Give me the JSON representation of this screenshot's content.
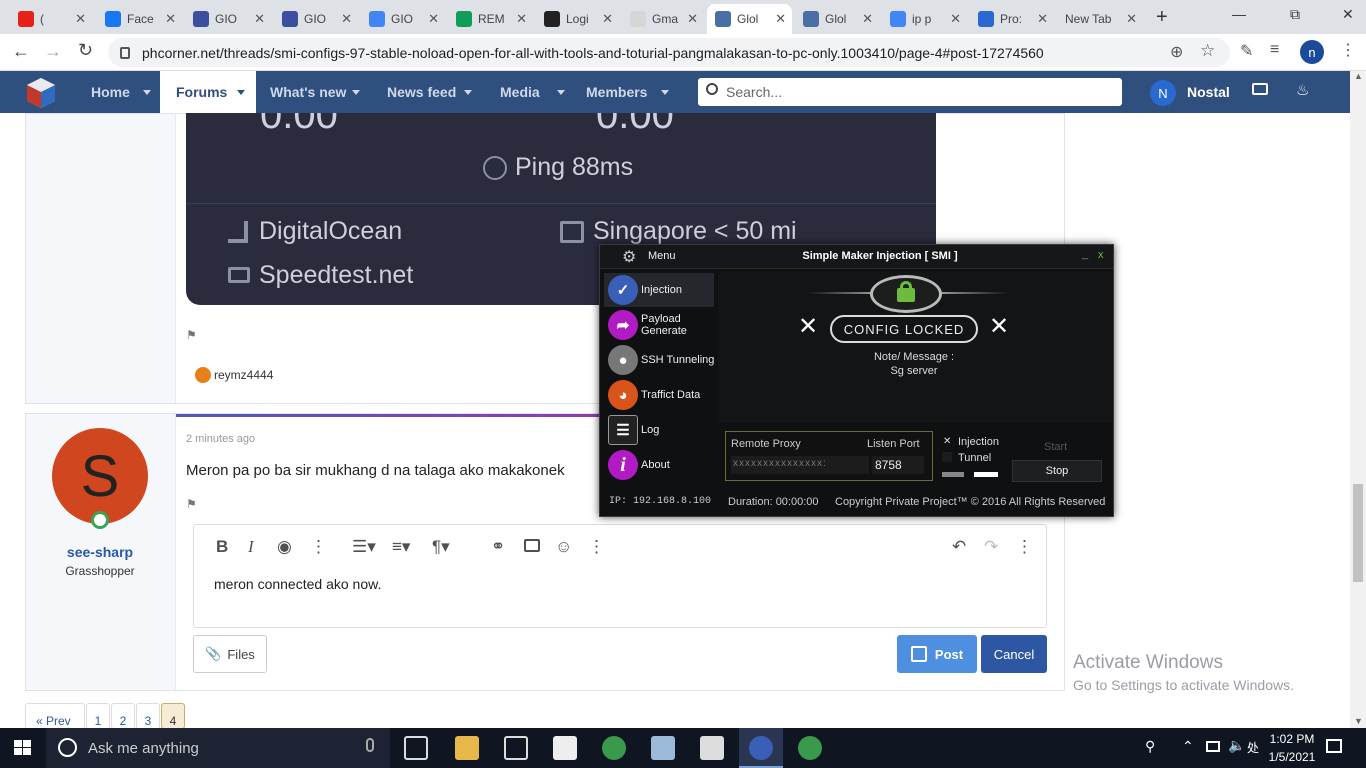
{
  "browser": {
    "tabs": [
      {
        "title": "(",
        "color": "#e62117",
        "active": false
      },
      {
        "title": "Face",
        "color": "#1877f2",
        "active": false
      },
      {
        "title": "GIO",
        "color": "#3c4f9e",
        "active": false
      },
      {
        "title": "GIO",
        "color": "#3c4f9e",
        "active": false
      },
      {
        "title": "GIO",
        "color": "#4285f4",
        "active": false
      },
      {
        "title": "REM",
        "color": "#0f9d58",
        "active": false
      },
      {
        "title": "Logi",
        "color": "#222222",
        "active": false
      },
      {
        "title": "Gma",
        "color": "#d6d6d6",
        "active": false
      },
      {
        "title": "Glol",
        "color": "#4a6fa5",
        "active": true
      },
      {
        "title": "Glol",
        "color": "#4a6fa5",
        "active": false
      },
      {
        "title": "ip p",
        "color": "#4285f4",
        "active": false
      },
      {
        "title": "Pro:",
        "color": "#2a6ad0",
        "active": false
      },
      {
        "title": "New Tab",
        "color": "",
        "active": false
      }
    ],
    "url": "phcorner.net/threads/smi-configs-97-stable-noload-open-for-all-with-tools-and-toturial-pangmalakasan-to-pc-only.1003410/page-4#post-17274560",
    "profile_initial": "n"
  },
  "site_nav": {
    "items": [
      "Home",
      "Forums",
      "What's new",
      "News feed",
      "Media",
      "Members"
    ],
    "search_placeholder": "Search...",
    "user_initial": "N",
    "username": "Nostal"
  },
  "speedtest": {
    "top_left": "0.00",
    "top_right": "0.00",
    "ping": "Ping 88ms",
    "provider": "DigitalOcean",
    "location": "Singapore < 50 mi",
    "site": "Speedtest.net"
  },
  "post1": {
    "reaction_user": "reymz4444"
  },
  "post2": {
    "avatar_letter": "S",
    "author": "see-sharp",
    "rank": "Grasshopper",
    "time": "2 minutes ago",
    "message": "Meron pa po ba sir mukhang d na talaga ako makakonek"
  },
  "editor": {
    "text": "meron connected ako now.",
    "files_label": "Files",
    "post_label": "Post",
    "cancel_label": "Cancel"
  },
  "pagination": {
    "prev": "« Prev",
    "pages": [
      "1",
      "2",
      "3",
      "4"
    ],
    "current": "4"
  },
  "smi": {
    "menu_label": "Menu",
    "title": "Simple Maker Injection [ SMI ]",
    "minimize": "_",
    "close": "x",
    "sidebar": [
      {
        "label": "Injection",
        "color": "#3a5fb8",
        "icon": "syringe-icon"
      },
      {
        "label": "Payload Generate",
        "color": "#b01bc4",
        "icon": "payload-icon"
      },
      {
        "label": "SSH Tunneling",
        "color": "#777777",
        "icon": "ssh-icon"
      },
      {
        "label": "Traffict Data",
        "color": "#d9541a",
        "icon": "gauge-icon"
      },
      {
        "label": "Log",
        "color": "#222222",
        "icon": "log-icon"
      },
      {
        "label": "About",
        "color": "#b01bc4",
        "icon": "info-icon"
      }
    ],
    "status": "CONFIG LOCKED",
    "note_label": "Note/ Message :",
    "note_value": "Sg server",
    "remote_proxy_label": "Remote Proxy",
    "remote_proxy_value": "xxxxxxxxxxxxxxx:",
    "listen_port_label": "Listen Port",
    "listen_port_value": "8758",
    "opt_injection": "Injection",
    "opt_tunnel": "Tunnel",
    "start_label": "Start",
    "stop_label": "Stop",
    "ip": "IP: 192.168.8.100",
    "duration": "Duration: 00:00:00",
    "copyright": "Copyright Private Project™ © 2016  All Rights Reserved"
  },
  "watermark": {
    "line1": "Activate Windows",
    "line2": "Go to Settings to activate Windows."
  },
  "taskbar": {
    "search_placeholder": "Ask me anything",
    "time": "1:02 PM",
    "date": "1/5/2021"
  }
}
